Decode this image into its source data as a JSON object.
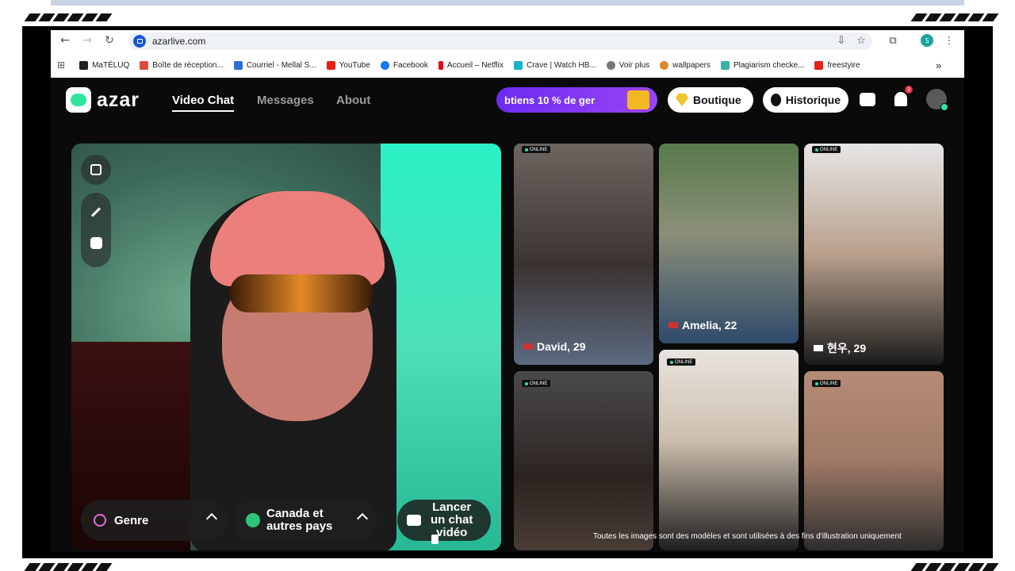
{
  "browser": {
    "url": "azarlive.com",
    "bookmarks": [
      "MaTÉLUQ",
      "Boîte de réception...",
      "Courriel - Mellal S...",
      "YouTube",
      "Facebook",
      "Accueil – Netflix",
      "Crave | Watch HB...",
      "Voir plus",
      "wallpapers",
      "Plagiarism checke...",
      "freestyire"
    ],
    "profile_initial": "S",
    "more": "»"
  },
  "app": {
    "logo_text": "azar",
    "nav": {
      "video_chat": "Video Chat",
      "messages": "Messages",
      "about": "About"
    },
    "promo": "btiens 10 % de ger",
    "boutique": "Boutique",
    "historique": "Historique",
    "notification_count": "3"
  },
  "video": {
    "genre_label": "Genre",
    "country_label_1": "Canada et",
    "country_label_2": "autres pays",
    "start_l1": "Lancer",
    "start_l2": "un chat",
    "start_l3": "vidéo"
  },
  "profiles": [
    {
      "name": "David, 29",
      "online": "ONLINE"
    },
    {
      "name": "Amelia, 22",
      "online": ""
    },
    {
      "name": "현우, 29",
      "online": "ONLINE"
    },
    {
      "name": "",
      "online": "ONLINE"
    },
    {
      "name": "",
      "online": "ONLINE"
    },
    {
      "name": "",
      "online": "ONLINE"
    }
  ],
  "caption": "Toutes les images sont des modèles et sont utilisées à des fins d'illustration uniquement"
}
